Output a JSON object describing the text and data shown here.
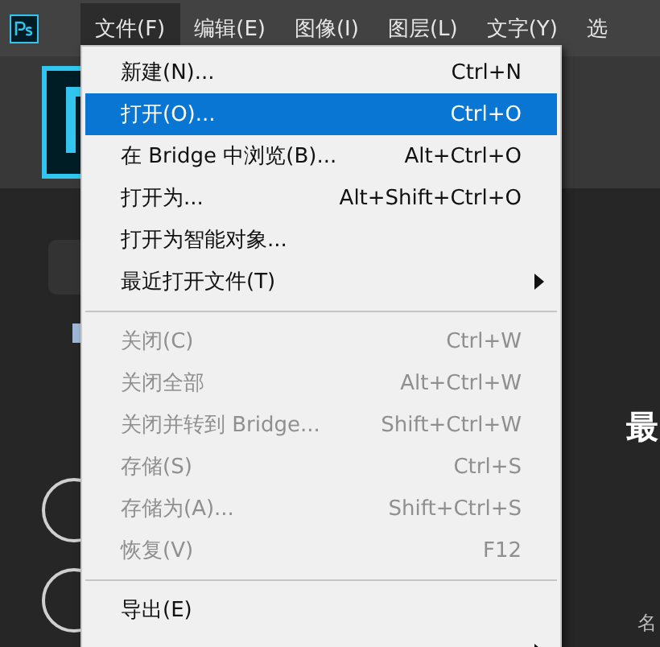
{
  "menubar": {
    "items": [
      {
        "label": "文件(F)",
        "selected": true
      },
      {
        "label": "编辑(E)",
        "selected": false
      },
      {
        "label": "图像(I)",
        "selected": false
      },
      {
        "label": "图层(L)",
        "selected": false
      },
      {
        "label": "文字(Y)",
        "selected": false
      },
      {
        "label": "选",
        "selected": false
      }
    ]
  },
  "home": {
    "heading": "最",
    "column_label": "名"
  },
  "file_menu": {
    "items": [
      {
        "kind": "item",
        "label": "新建(N)...",
        "shortcut": "Ctrl+N",
        "disabled": false,
        "selected": false
      },
      {
        "kind": "item",
        "label": "打开(O)...",
        "shortcut": "Ctrl+O",
        "disabled": false,
        "selected": true
      },
      {
        "kind": "item",
        "label": "在 Bridge 中浏览(B)...",
        "shortcut": "Alt+Ctrl+O",
        "disabled": false,
        "selected": false
      },
      {
        "kind": "item",
        "label": "打开为...",
        "shortcut": "Alt+Shift+Ctrl+O",
        "disabled": false,
        "selected": false
      },
      {
        "kind": "item",
        "label": "打开为智能对象...",
        "disabled": false,
        "selected": false
      },
      {
        "kind": "submenu",
        "label": "最近打开文件(T)",
        "disabled": false,
        "selected": false
      },
      {
        "kind": "separator"
      },
      {
        "kind": "item",
        "label": "关闭(C)",
        "shortcut": "Ctrl+W",
        "disabled": true,
        "selected": false
      },
      {
        "kind": "item",
        "label": "关闭全部",
        "shortcut": "Alt+Ctrl+W",
        "disabled": true,
        "selected": false
      },
      {
        "kind": "item",
        "label": "关闭并转到 Bridge...",
        "shortcut": "Shift+Ctrl+W",
        "disabled": true,
        "selected": false
      },
      {
        "kind": "item",
        "label": "存储(S)",
        "shortcut": "Ctrl+S",
        "disabled": true,
        "selected": false
      },
      {
        "kind": "item",
        "label": "存储为(A)...",
        "shortcut": "Shift+Ctrl+S",
        "disabled": true,
        "selected": false
      },
      {
        "kind": "item",
        "label": "恢复(V)",
        "shortcut": "F12",
        "disabled": true,
        "selected": false
      },
      {
        "kind": "separator"
      },
      {
        "kind": "item",
        "label": "导出(E)",
        "disabled": false,
        "selected": false
      },
      {
        "kind": "submenu",
        "selected": false
      }
    ]
  }
}
